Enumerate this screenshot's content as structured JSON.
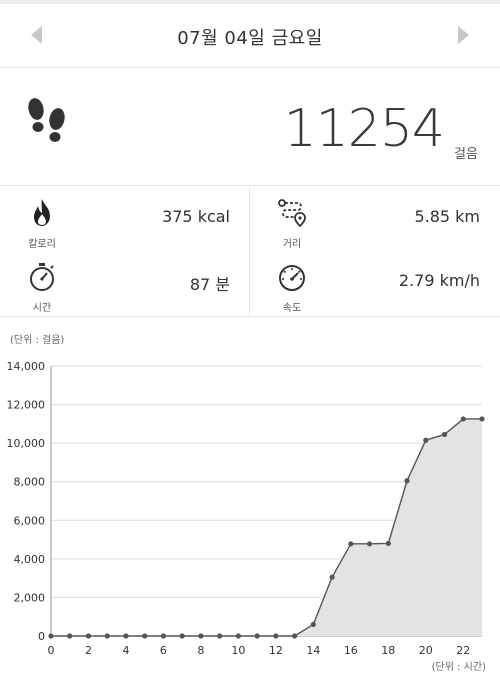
{
  "header": {
    "date_title": "07월 04일 금요일",
    "prev_icon": "triangle-left-icon",
    "next_icon": "triangle-right-icon"
  },
  "steps": {
    "icon": "footprints-icon",
    "value": "11254",
    "unit": "걸음"
  },
  "stats": {
    "calories": {
      "icon": "flame-icon",
      "label": "칼로리",
      "value": "375 kcal"
    },
    "distance": {
      "icon": "route-icon",
      "label": "거리",
      "value": "5.85 km"
    },
    "time": {
      "icon": "stopwatch-icon",
      "label": "시간",
      "value": "87 분"
    },
    "speed": {
      "icon": "speedometer-icon",
      "label": "속도",
      "value": "2.79 km/h"
    }
  },
  "colors": {
    "line": "#555555",
    "fill": "#e3e3e3",
    "grid": "#dddddd",
    "icon": "#333333",
    "flame": "#222222"
  },
  "chart_data": {
    "type": "area",
    "y_unit_label": "(단위 : 걸음)",
    "x_unit_label": "(단위 : 시간)",
    "ylim": [
      0,
      14000
    ],
    "yticks": [
      "14,000",
      "12,000",
      "10,000",
      "8,000",
      "6,000",
      "4,000",
      "2,000",
      "0"
    ],
    "ytick_values": [
      14000,
      12000,
      10000,
      8000,
      6000,
      4000,
      2000,
      0
    ],
    "xlim": [
      0,
      23
    ],
    "xticks": [
      "0",
      "2",
      "4",
      "6",
      "8",
      "10",
      "12",
      "14",
      "16",
      "18",
      "20",
      "22"
    ],
    "xtick_values": [
      0,
      2,
      4,
      6,
      8,
      10,
      12,
      14,
      16,
      18,
      20,
      22
    ],
    "grid": true,
    "x": [
      0,
      1,
      2,
      3,
      4,
      5,
      6,
      7,
      8,
      9,
      10,
      11,
      12,
      13,
      14,
      15,
      16,
      17,
      18,
      19,
      20,
      21,
      22,
      23
    ],
    "values": [
      0,
      0,
      0,
      0,
      0,
      0,
      0,
      0,
      0,
      0,
      0,
      0,
      0,
      0,
      600,
      3050,
      4780,
      4780,
      4800,
      8050,
      10150,
      10450,
      11254,
      11254
    ]
  }
}
